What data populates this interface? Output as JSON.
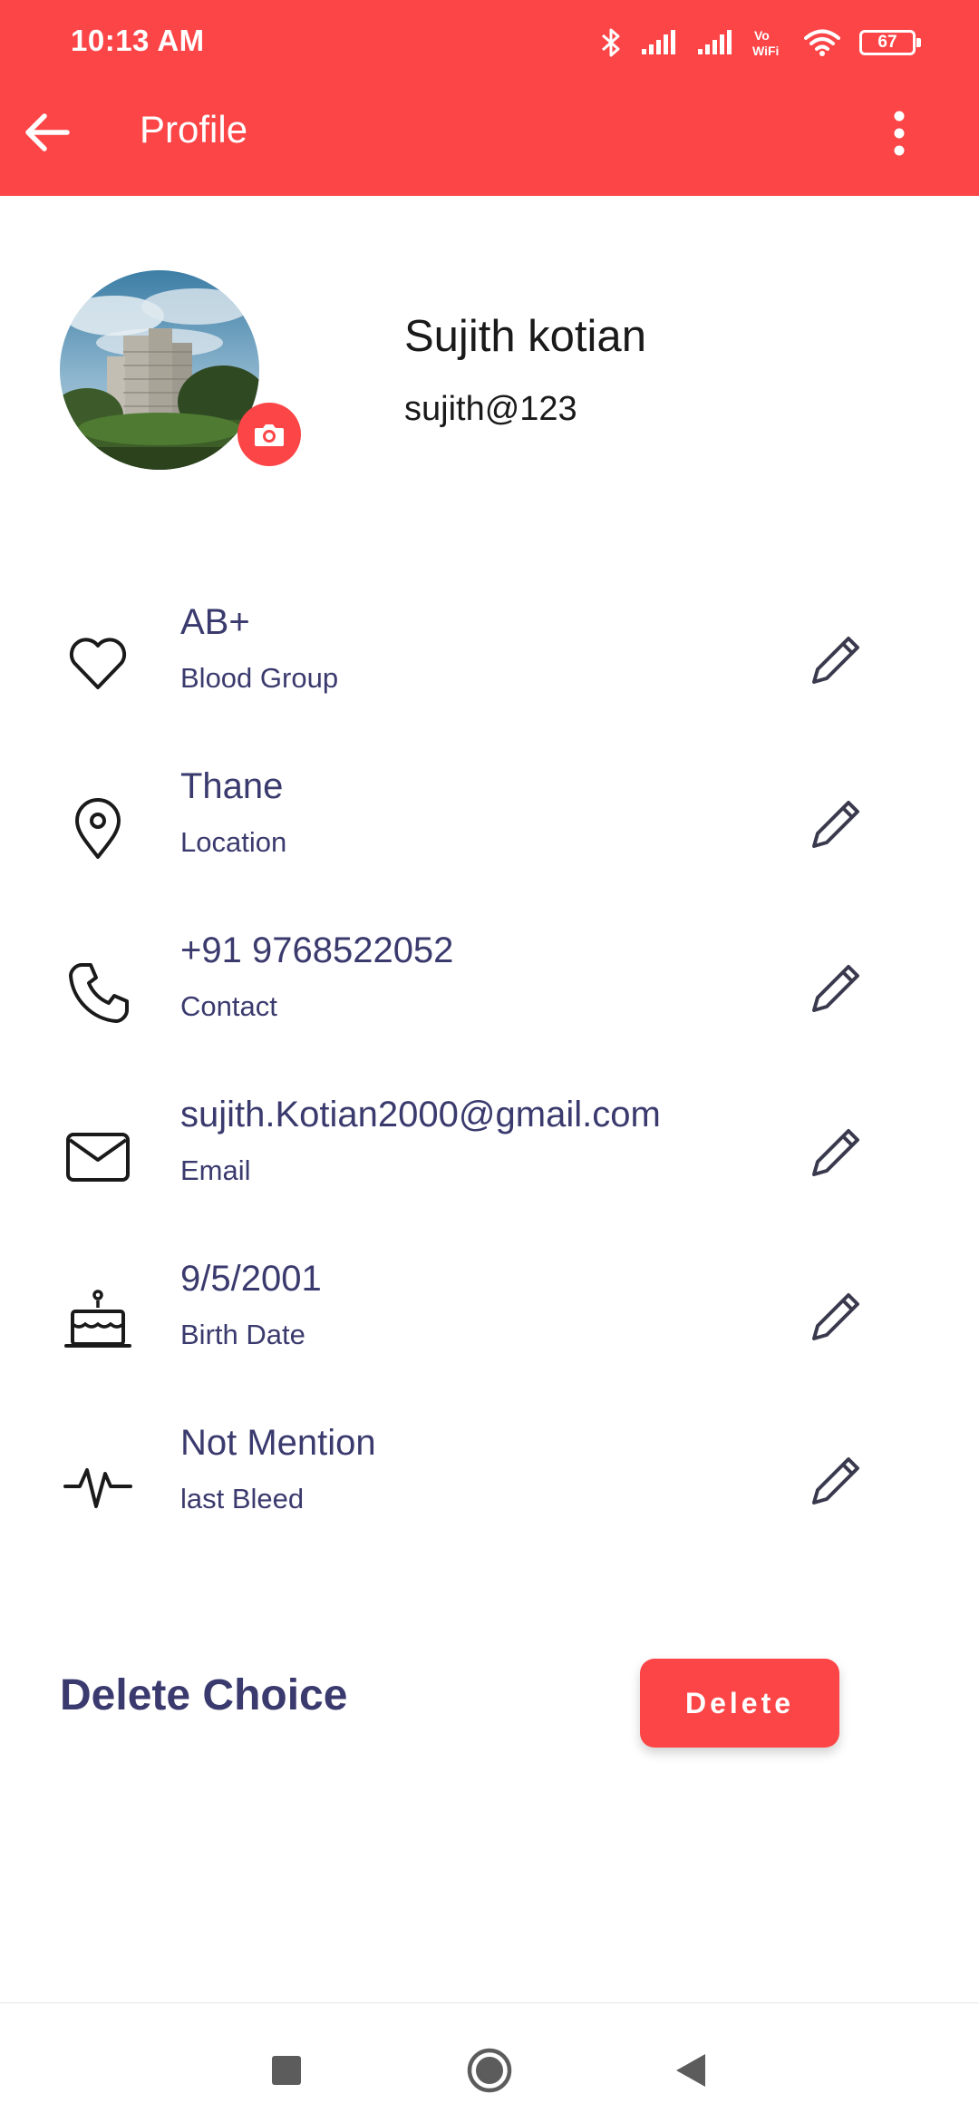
{
  "status_bar": {
    "time": "10:13 AM",
    "battery": "67",
    "icons": [
      "bluetooth-icon",
      "signal-icon",
      "signal-icon",
      "vowifi-icon",
      "wifi-icon",
      "battery-icon"
    ]
  },
  "app_bar": {
    "title": "Profile",
    "back_icon": "back-arrow-icon",
    "menu_icon": "more-vert-icon"
  },
  "profile": {
    "name": "Sujith kotian",
    "username": "sujith@123"
  },
  "fields": [
    {
      "value": "AB+",
      "label": "Blood Group",
      "icon": "heart-icon"
    },
    {
      "value": "Thane",
      "label": "Location",
      "icon": "location-pin-icon"
    },
    {
      "value": "+91 9768522052",
      "label": "Contact",
      "icon": "phone-icon"
    },
    {
      "value": "sujith.Kotian2000@gmail.com",
      "label": "Email",
      "icon": "mail-icon"
    },
    {
      "value": "9/5/2001",
      "label": "Birth Date",
      "icon": "cake-icon"
    },
    {
      "value": "Not Mention",
      "label": "last Bleed",
      "icon": "heartbeat-icon"
    }
  ],
  "delete_section": {
    "title": "Delete Choice",
    "button_label": "Delete"
  },
  "colors": {
    "accent": "#fc4547",
    "text_primary": "#3a3a6e"
  }
}
